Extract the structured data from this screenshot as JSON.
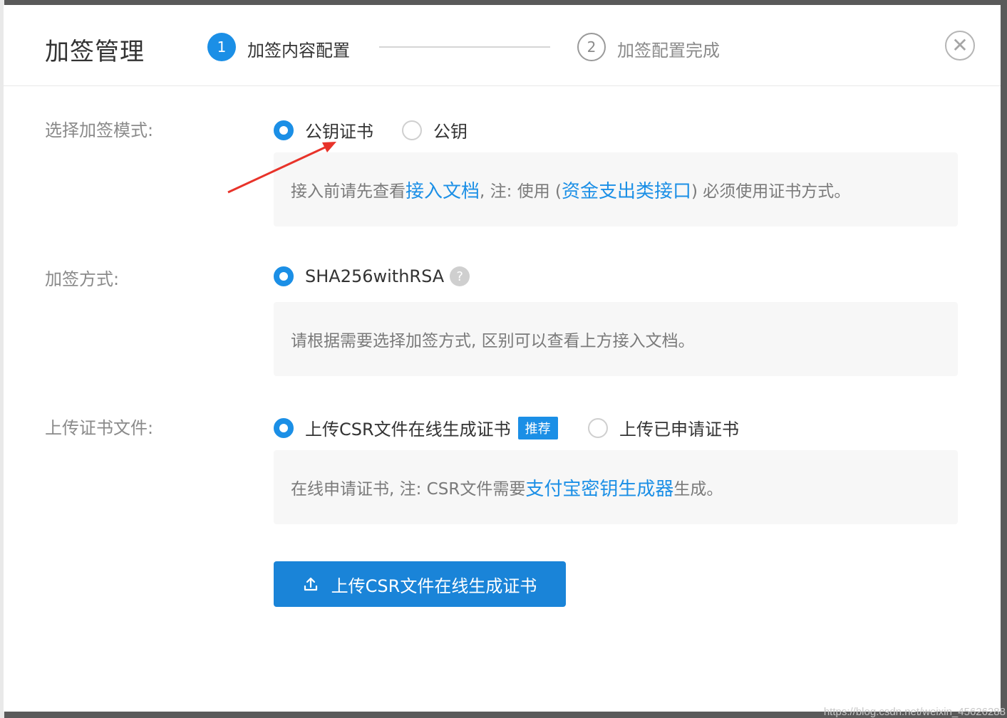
{
  "header": {
    "title": "加签管理",
    "steps": [
      {
        "number": "1",
        "label": "加签内容配置",
        "status": "active"
      },
      {
        "number": "2",
        "label": "加签配置完成",
        "status": "pending"
      }
    ],
    "close_glyph": "✕"
  },
  "sign_mode": {
    "label": "选择加签模式:",
    "options": [
      {
        "label": "公钥证书",
        "checked": true
      },
      {
        "label": "公钥",
        "checked": false
      }
    ],
    "note": {
      "prefix": "接入前请先查看",
      "link1": "接入文档",
      "middle": ", 注: 使用 (",
      "link2": "资金支出类接口",
      "suffix": ") 必须使用证书方式。"
    }
  },
  "sign_method": {
    "label": "加签方式:",
    "option": {
      "label": "SHA256withRSA",
      "checked": true
    },
    "help_glyph": "?",
    "note": "请根据需要选择加签方式, 区别可以查看上方接入文档。"
  },
  "upload_cert": {
    "label": "上传证书文件:",
    "options": [
      {
        "label": "上传CSR文件在线生成证书",
        "checked": true,
        "badge": "推荐"
      },
      {
        "label": "上传已申请证书",
        "checked": false
      }
    ],
    "note": {
      "prefix": "在线申请证书, 注: CSR文件需要",
      "link": "支付宝密钥生成器",
      "suffix": "生成。"
    }
  },
  "upload_button": {
    "label": "上传CSR文件在线生成证书",
    "icon": "upload-icon"
  },
  "watermark": "https://blog.csdn.net/weixin_45626288",
  "colors": {
    "primary": "#1b8fe6",
    "annotation_arrow": "#e8332a"
  }
}
